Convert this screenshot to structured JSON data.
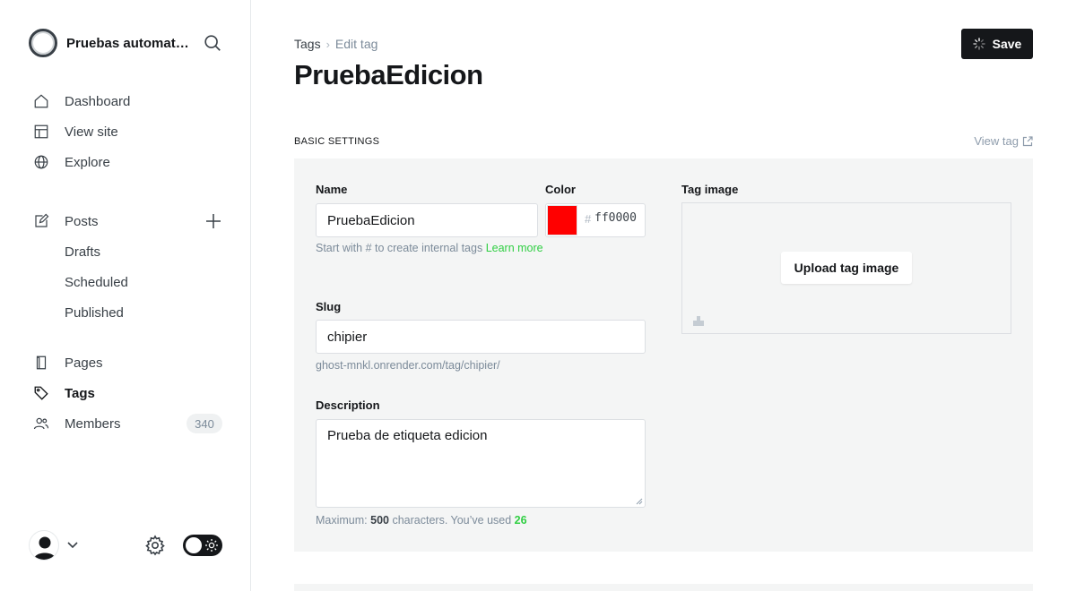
{
  "sidebar": {
    "site_title": "Pruebas automatizadas",
    "nav": {
      "dashboard": "Dashboard",
      "view_site": "View site",
      "explore": "Explore",
      "posts": "Posts",
      "drafts": "Drafts",
      "scheduled": "Scheduled",
      "published": "Published",
      "pages": "Pages",
      "tags": "Tags",
      "members": "Members",
      "members_count": "340"
    }
  },
  "header": {
    "breadcrumb_parent": "Tags",
    "breadcrumb_sep": "›",
    "breadcrumb_current": "Edit tag",
    "title": "PruebaEdicion",
    "save_label": "Save"
  },
  "section": {
    "label": "BASIC SETTINGS",
    "view_tag": "View tag"
  },
  "form": {
    "name_label": "Name",
    "name_value": "PruebaEdicion",
    "name_help_pre": "Start with # to create internal tags ",
    "name_help_link": "Learn more",
    "color_label": "Color",
    "color_hash": "#",
    "color_value": "ff0000",
    "color_swatch": "#ff0000",
    "slug_label": "Slug",
    "slug_value": "chipier",
    "slug_help": "ghost-mnkl.onrender.com/tag/chipier/",
    "description_label": "Description",
    "description_value": "Prueba de etiqueta edicion",
    "desc_help_pre": "Maximum: ",
    "desc_help_max": "500",
    "desc_help_mid": " characters. You’ve used ",
    "desc_help_used": "26",
    "tag_image_label": "Tag image",
    "upload_label": "Upload tag image"
  },
  "colors": {
    "accent_green": "#30cf43",
    "primary_dark": "#15171a",
    "panel_bg": "#f4f5f5"
  }
}
